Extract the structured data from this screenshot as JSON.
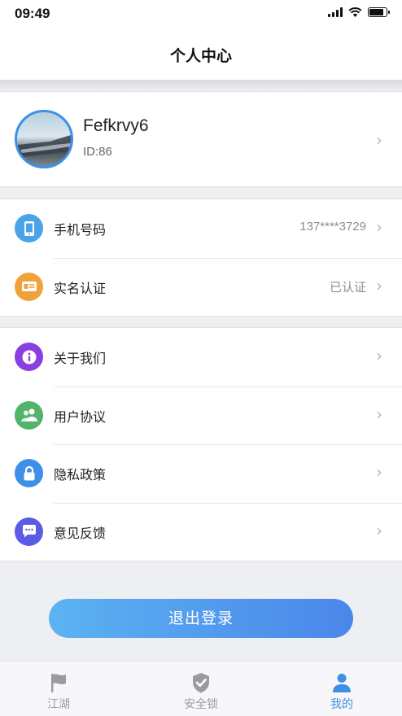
{
  "status_bar": {
    "time": "09:49"
  },
  "nav": {
    "title": "个人中心"
  },
  "profile": {
    "name": "Fefkrvy6",
    "id": "ID:86"
  },
  "account_group": [
    {
      "label": "手机号码",
      "value": "137****3729",
      "icon": "phone-icon",
      "color": "#4aa3e6"
    },
    {
      "label": "实名认证",
      "value": "已认证",
      "icon": "id-card-icon",
      "color": "#f0a23a"
    }
  ],
  "info_group": [
    {
      "label": "关于我们",
      "icon": "info-icon",
      "color": "#8a3fe0"
    },
    {
      "label": "用户协议",
      "icon": "users-icon",
      "color": "#52b36a"
    },
    {
      "label": "隐私政策",
      "icon": "lock-icon",
      "color": "#3d8fe8"
    },
    {
      "label": "意见反馈",
      "icon": "chat-icon",
      "color": "#5a5ce6"
    }
  ],
  "logout": {
    "label": "退出登录"
  },
  "tabs": [
    {
      "label": "江湖",
      "icon": "flag-icon",
      "active": false
    },
    {
      "label": "安全锁",
      "icon": "shield-check-icon",
      "active": false
    },
    {
      "label": "我的",
      "icon": "person-icon",
      "active": true
    }
  ],
  "colors": {
    "accent": "#3d8fe8",
    "inactive": "#9a9aa0"
  }
}
